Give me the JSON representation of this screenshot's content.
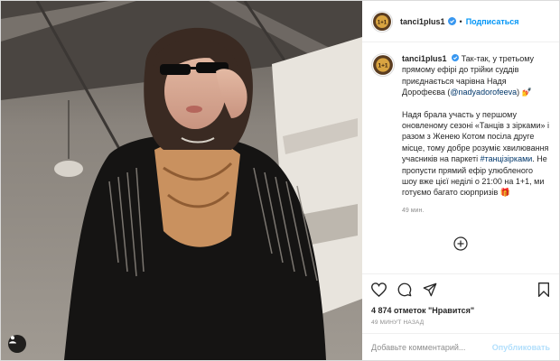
{
  "header": {
    "username": "tanci1plus1",
    "separator": "•",
    "follow_label": "Подписаться"
  },
  "caption": {
    "username": "tanci1plus1",
    "p1_text": "Так-так, у третьому прямому ефірі до трійки суддів приєднається чарівна Надя Дорофеєва (",
    "mention": "@nadyadorofeeva",
    "p1_end": ") 💅",
    "p2_start": "Надя брала участь у першому оновленому сезоні «Танців з зірками» і разом з Женею Котом посіла друге місце, тому добре розуміє хвилювання учасників на паркеті ",
    "hashtag": "#танцізірками",
    "p2_end": ". Не пропусти прямий ефір улюбленого шоу вже цієї неділі о 21:00 на 1+1, ми готуємо багато сюрпризів 🎁",
    "time": "49 мин."
  },
  "likes": "4 874 отметок \"Нравится\"",
  "posted": "49 МИНУТ НАЗАД",
  "comment": {
    "placeholder": "Добавьте комментарий...",
    "publish_label": "Опубликовать"
  },
  "icons": {
    "verified": "verified-icon",
    "more": "load-more-icon",
    "like": "heart-icon",
    "comment": "comment-icon",
    "share": "share-icon",
    "save": "bookmark-icon",
    "account": "tagged-account-icon"
  },
  "colors": {
    "accent": "#0095f6",
    "link": "#00376b",
    "muted": "#8e8e8e"
  }
}
